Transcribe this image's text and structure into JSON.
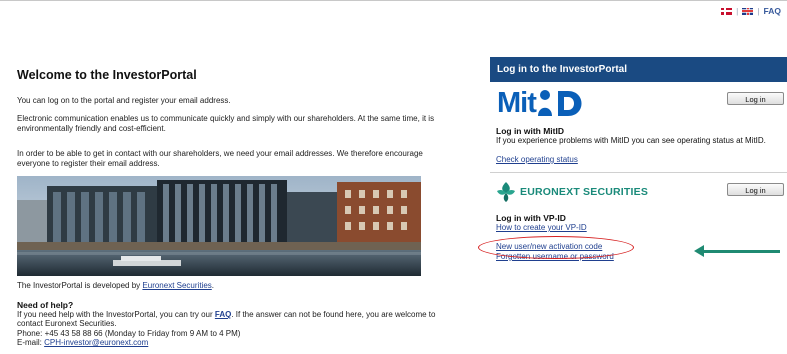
{
  "topbar": {
    "separator": "|",
    "faq": "FAQ"
  },
  "welcome": {
    "title": "Welcome to the InvestorPortal",
    "p1": "You can log on to the portal and register your email address.",
    "p2": "Electronic communication enables us to communicate quickly and simply with our shareholders. At the same time, it is environmentally friendly and cost-efficient.",
    "p3": "In order to be able to get in contact with our shareholders, we need your email addresses. We therefore encourage everyone to register their email address.",
    "developed_prefix": "The InvestorPortal is developed by ",
    "developed_link": "Euronext Securities",
    "developed_suffix": "."
  },
  "help": {
    "title": "Need of help?",
    "line1_prefix": "If you need help with the InvestorPortal, you can try our ",
    "line1_link": "FAQ",
    "line1_suffix": ". If the answer can not be found here, you are welcome to contact Euronext Securities.",
    "phone": "Phone: +45 43 58 88 66 (Monday to Friday from 9 AM to 4 PM)",
    "email_prefix": "E-mail: ",
    "email_link": "CPH-investor@euronext.com"
  },
  "login": {
    "header": "Log in to the InvestorPortal",
    "mitid": {
      "logo_text": "Mit",
      "button": "Log in",
      "title": "Log in with MitID",
      "desc": "If you experience problems with MitID you can see operating status at MitID.",
      "link": "Check operating status"
    },
    "vpid": {
      "logo_text": "EURONEXT SECURITIES",
      "button": "Log in",
      "title": "Log in with VP-ID",
      "link_create": "How to create your VP-ID",
      "link_activation": "New user/new activation code",
      "link_forgotten": "Forgotten username or password"
    }
  },
  "colors": {
    "panel_header": "#1a4a82",
    "mitid_blue": "#0a5fb8",
    "euronext_green": "#1a8a7a",
    "highlight_oval": "#d62020",
    "arrow": "#1f8a72",
    "link": "#1f3f8f"
  },
  "icons": [
    "danish-flag-icon",
    "uk-flag-icon",
    "mitid-logo-icon",
    "euronext-logo-icon",
    "arrow-left-icon"
  ]
}
